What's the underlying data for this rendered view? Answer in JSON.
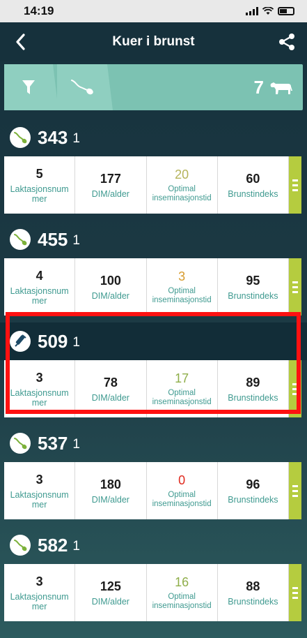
{
  "status_bar": {
    "time": "14:19"
  },
  "nav": {
    "title": "Kuer i brunst"
  },
  "filter": {
    "count": "7"
  },
  "labels": {
    "lactation": "Laktasjonsnum mer",
    "dim": "DIM/alder",
    "optimal": "Optimal inseminasjonstid",
    "heat_index": "Brunstindeks"
  },
  "cows": [
    {
      "id": "343",
      "lactation_count": "1",
      "icon": "sperm-icon",
      "lactation": "5",
      "dim": "177",
      "optimal": "20",
      "optimal_color": "#b5b35a",
      "heat_index": "60"
    },
    {
      "id": "455",
      "lactation_count": "1",
      "icon": "sperm-icon",
      "lactation": "4",
      "dim": "100",
      "optimal": "3",
      "optimal_color": "#d79b2d",
      "heat_index": "95"
    },
    {
      "id": "509",
      "lactation_count": "1",
      "icon": "syringe-icon",
      "lactation": "3",
      "dim": "78",
      "optimal": "17",
      "optimal_color": "#8fae4a",
      "heat_index": "89"
    },
    {
      "id": "537",
      "lactation_count": "1",
      "icon": "sperm-icon",
      "lactation": "3",
      "dim": "180",
      "optimal": "0",
      "optimal_color": "#e02a1e",
      "heat_index": "96"
    },
    {
      "id": "582",
      "lactation_count": "1",
      "icon": "sperm-icon",
      "lactation": "3",
      "dim": "125",
      "optimal": "16",
      "optimal_color": "#8fae4a",
      "heat_index": "88"
    }
  ],
  "colors": {
    "accent": "#7cc2b2",
    "label": "#3f9a90",
    "menu_strip": "#b5cc3f",
    "highlight": "#ff1111"
  }
}
